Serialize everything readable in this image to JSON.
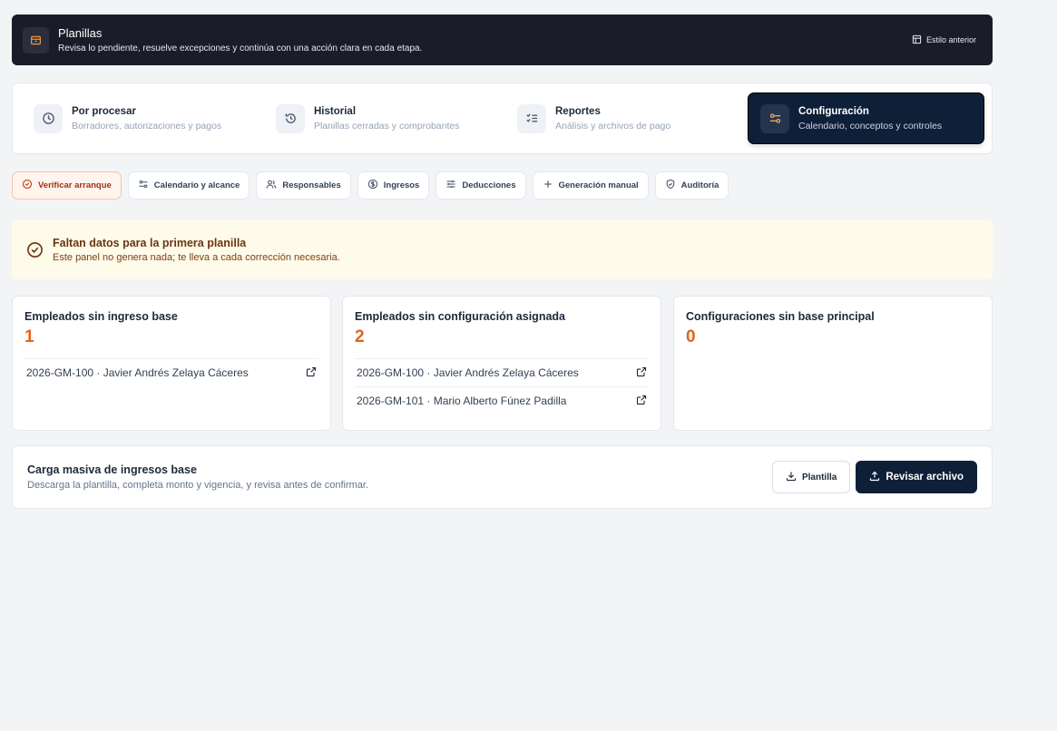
{
  "header": {
    "title": "Planillas",
    "subtitle": "Revisa lo pendiente, resuelve excepciones y continúa con una acción clara en cada etapa.",
    "legacy_label": "Estilo anterior"
  },
  "stages": [
    {
      "title": "Por procesar",
      "subtitle": "Borradores, autorizaciones y pagos",
      "icon": "clock-icon",
      "active": false
    },
    {
      "title": "Historial",
      "subtitle": "Planillas cerradas y comprobantes",
      "icon": "history-icon",
      "active": false
    },
    {
      "title": "Reportes",
      "subtitle": "Análisis y archivos de pago",
      "icon": "checklist-icon",
      "active": false
    },
    {
      "title": "Configuración",
      "subtitle": "Calendario, conceptos y controles",
      "icon": "settings-sliders-icon",
      "active": true
    }
  ],
  "tabs": [
    {
      "label": "Verificar arranque",
      "icon": "check-circle-icon",
      "active": true
    },
    {
      "label": "Calendario y alcance",
      "icon": "sliders-icon",
      "active": false
    },
    {
      "label": "Responsables",
      "icon": "users-icon",
      "active": false
    },
    {
      "label": "Ingresos",
      "icon": "dollar-circle-icon",
      "active": false
    },
    {
      "label": "Deducciones",
      "icon": "adjustments-icon",
      "active": false
    },
    {
      "label": "Generación manual",
      "icon": "plus-icon",
      "active": false
    },
    {
      "label": "Auditoría",
      "icon": "shield-check-icon",
      "active": false
    }
  ],
  "alert": {
    "title": "Faltan datos para la primera planilla",
    "subtitle": "Este panel no genera nada; te lleva a cada corrección necesaria."
  },
  "cards": [
    {
      "title": "Empleados sin ingreso base",
      "count": "1",
      "rows": [
        "2026-GM-100 · Javier Andrés Zelaya Cáceres"
      ]
    },
    {
      "title": "Empleados sin configuración asignada",
      "count": "2",
      "rows": [
        "2026-GM-100 · Javier Andrés Zelaya Cáceres",
        "2026-GM-101 · Mario Alberto Fúnez Padilla"
      ]
    },
    {
      "title": "Configuraciones sin base principal",
      "count": "0",
      "rows": []
    }
  ],
  "bulk": {
    "title": "Carga masiva de ingresos base",
    "subtitle": "Descarga la plantilla, completa monto y vigencia, y revisa antes de confirmar.",
    "template_label": "Plantilla",
    "review_label": "Revisar archivo"
  },
  "colors": {
    "accent": "#e2631b",
    "dark": "#0e1f38",
    "header_bg": "#1a1d29",
    "alert_bg": "#fffbea"
  }
}
